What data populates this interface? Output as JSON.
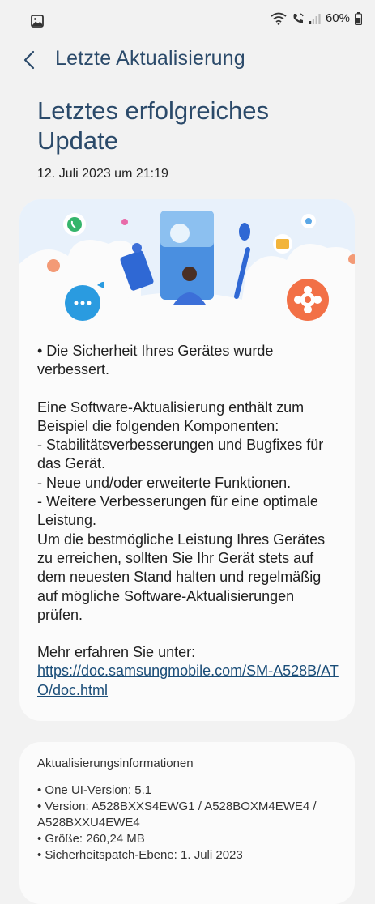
{
  "status_bar": {
    "battery": "60%"
  },
  "app_bar": {
    "title": "Letzte Aktualisierung"
  },
  "page": {
    "title": "Letztes erfolgreiches Update",
    "date": "12. Juli 2023 um 21:19"
  },
  "release_notes": {
    "security": "• Die Sicherheit Ihres Gerätes wurde verbessert.",
    "intro": "Eine Software-Aktualisierung enthält zum Beispiel die folgenden Komponenten:",
    "item1": " - Stabilitätsverbesserungen und Bugfixes für das Gerät.",
    "item2": " - Neue und/oder erweiterte Funktionen.",
    "item3": " - Weitere Verbesserungen für eine optimale Leistung.",
    "advice": "Um die bestmögliche Leistung Ihres Gerätes zu erreichen, sollten Sie Ihr Gerät stets auf dem neuesten Stand halten und regelmäßig auf mögliche Software-Aktualisierungen prüfen.",
    "more_label": "Mehr erfahren Sie unter:",
    "link": "https://doc.samsungmobile.com/SM-A528B/ATO/doc.html"
  },
  "update_info": {
    "title": "Aktualisierungsinformationen",
    "items": [
      "• One UI-Version: 5.1",
      "• Version: A528BXXS4EWG1 / A528BOXM4EWE4 / A528BXXU4EWE4",
      "• Größe: 260,24 MB",
      "• Sicherheitspatch-Ebene: 1. Juli 2023"
    ]
  },
  "icons": {
    "status_left": "gallery-icon",
    "back": "back-arrow-icon"
  },
  "colors": {
    "title_blue": "#2b4a6a",
    "link_blue": "#1a4d78",
    "background": "#f2f2f2",
    "card": "#fbfbfb"
  }
}
